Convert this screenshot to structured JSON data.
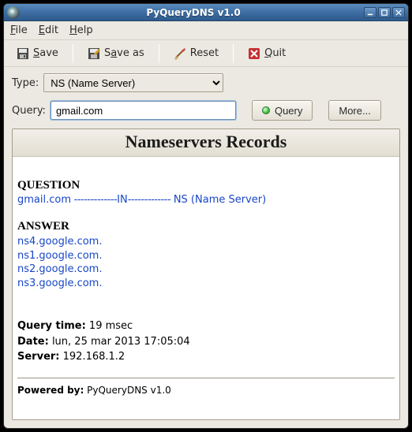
{
  "window": {
    "title": "PyQueryDNS v1.0"
  },
  "menu": {
    "file": "File",
    "edit": "Edit",
    "help": "Help"
  },
  "toolbar": {
    "save": "Save",
    "save_as": "Save as",
    "reset": "Reset",
    "quit": "Quit"
  },
  "controls": {
    "type_label": "Type:",
    "type_value": "NS (Name Server)",
    "query_label": "Query:",
    "query_value": "gmail.com",
    "query_btn": "Query",
    "more_btn": "More..."
  },
  "results": {
    "header": "Nameservers Records",
    "question_title": "QUESTION",
    "question": {
      "name": "gmail.com",
      "sep1": " -------------",
      "class": "IN",
      "sep2": "------------- ",
      "type": "NS (Name Server)"
    },
    "answer_title": "ANSWER",
    "answers": [
      "ns4.google.com.",
      "ns1.google.com.",
      "ns2.google.com.",
      "ns3.google.com."
    ],
    "meta": {
      "query_time_label": "Query time:",
      "query_time_value": "19 msec",
      "date_label": "Date:",
      "date_value": "lun, 25 mar 2013 17:05:04",
      "server_label": "Server:",
      "server_value": "192.168.1.2"
    },
    "powered_label": "Powered by:",
    "powered_value": "PyQueryDNS v1.0"
  }
}
